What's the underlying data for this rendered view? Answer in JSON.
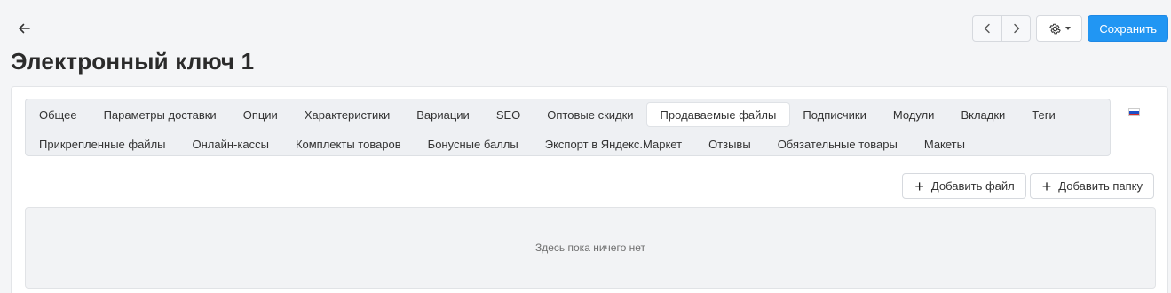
{
  "header": {
    "back_icon": "arrow-left-icon",
    "title": "Электронный ключ 1",
    "prev_icon": "chevron-left-icon",
    "next_icon": "chevron-right-icon",
    "settings_icon": "gear-icon",
    "save_label": "Сохранить",
    "accent_color": "#2196f3"
  },
  "tabs": {
    "row1": [
      "Общее",
      "Параметры доставки",
      "Опции",
      "Характеристики",
      "Вариации",
      "SEO",
      "Оптовые скидки",
      "Продаваемые файлы",
      "Подписчики",
      "Модули",
      "Вкладки",
      "Теги"
    ],
    "row2": [
      "Прикрепленные файлы",
      "Онлайн-кассы",
      "Комплекты товаров",
      "Бонусные баллы",
      "Экспорт в Яндекс.Маркет",
      "Отзывы",
      "Обязательные товары",
      "Макеты"
    ],
    "active": "Продаваемые файлы",
    "language_flag": "russia-flag-icon"
  },
  "files": {
    "add_file_label": "Добавить файл",
    "add_folder_label": "Добавить папку",
    "empty_text": "Здесь пока ничего нет"
  }
}
